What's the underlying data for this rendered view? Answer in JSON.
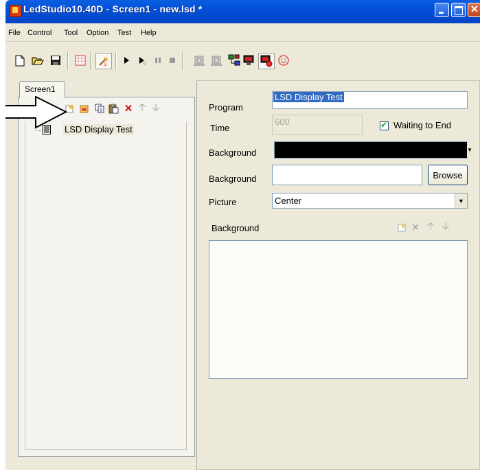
{
  "window": {
    "title": "LedStudio10.40D - Screen1 - new.lsd *"
  },
  "menu": [
    "File",
    "Control",
    "Tool",
    "Option",
    "Test",
    "Help"
  ],
  "toolbar": {
    "icons": [
      "new-file-icon",
      "open-folder-icon",
      "save-icon",
      "grid-icon",
      "edit-wand-icon",
      "play-icon",
      "step-play-icon",
      "pause-icon",
      "stop-icon",
      "capture-icon",
      "capture-alt-icon",
      "network-icon",
      "screen-icon",
      "screen-send-icon",
      "smile-icon"
    ]
  },
  "left": {
    "tab_label": "Screen1",
    "tree_item_label": "LSD Display Test"
  },
  "form": {
    "program_label": "Program",
    "program_value": "LSD Display Test",
    "time_label": "Time",
    "time_value": "600",
    "waiting_label": "Waiting to End",
    "waiting_checked": true,
    "background_color_label": "Background",
    "background_color": "#000000",
    "background_image_label": "Background",
    "background_image_value": "",
    "browse_label": "Browse",
    "picture_label": "Picture",
    "picture_value": "Center",
    "background_list_label": "Background"
  },
  "colors": {
    "titlebar": "#0350d8",
    "selection": "#316ac5",
    "face": "#ece9d8"
  }
}
